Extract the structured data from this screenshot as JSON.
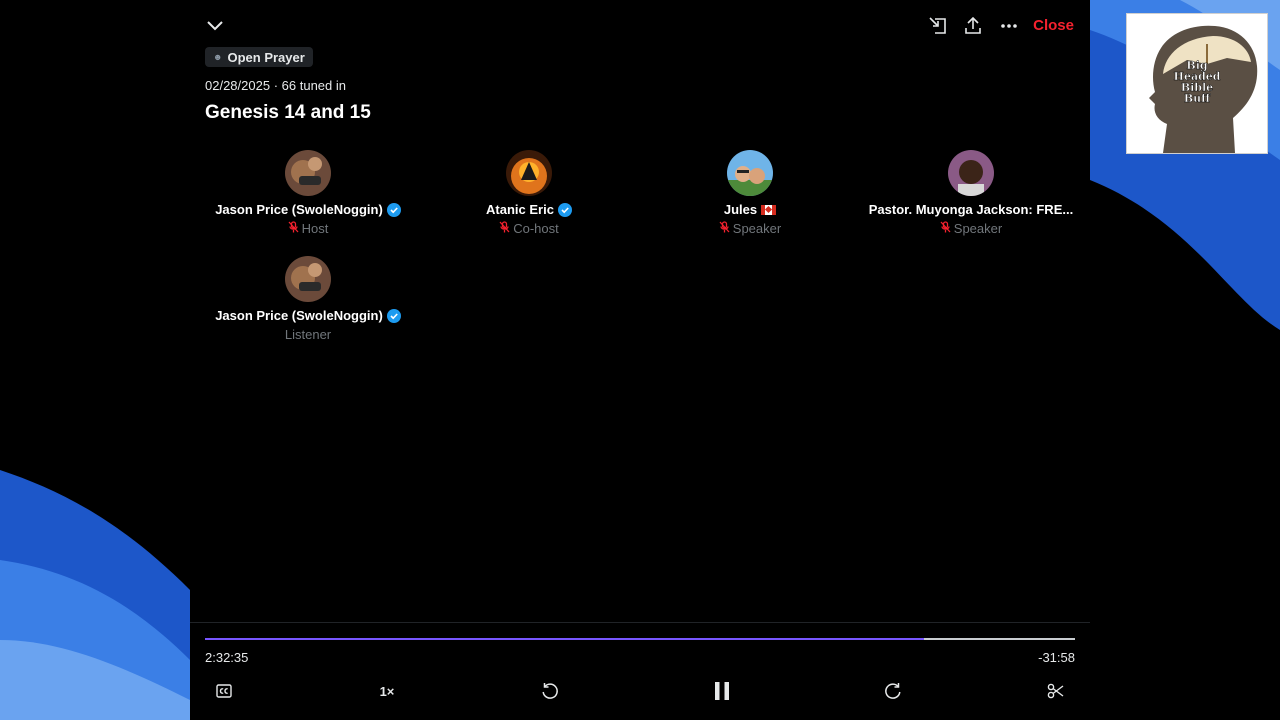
{
  "header": {
    "close_label": "Close"
  },
  "space": {
    "tag_label": "Open Prayer",
    "date": "02/28/2025",
    "tuned_in": "66 tuned in",
    "title": "Genesis 14 and 15"
  },
  "participants": [
    {
      "name": "Jason Price (SwoleNoggin)",
      "role": "Host",
      "verified": true,
      "muted": true
    },
    {
      "name": "Atanic Eric",
      "role": "Co-host",
      "verified": true,
      "muted": true
    },
    {
      "name": "Jules",
      "role": "Speaker",
      "verified": false,
      "muted": true,
      "flag": "canada"
    },
    {
      "name": "Pastor. Muyonga Jackson: FRE...",
      "role": "Speaker",
      "verified": false,
      "muted": true
    },
    {
      "name": "Jason Price (SwoleNoggin)",
      "role": "Listener",
      "verified": true,
      "muted": false
    }
  ],
  "player": {
    "elapsed": "2:32:35",
    "remaining": "-31:58",
    "progress_fraction": 0.827,
    "speed_label": "1×",
    "skip_back_label": "15",
    "skip_forward_label": "15"
  },
  "logo": {
    "text_line1": "Big",
    "text_line2": "Headed",
    "text_line3": "Bible",
    "text_line4": "Buff"
  },
  "icons": {
    "collapse": "chevron-down-icon",
    "minimize": "dock-icon",
    "share": "share-icon",
    "more": "more-icon",
    "captions": "captions-icon",
    "rewind": "rewind-15-icon",
    "pause": "pause-icon",
    "forward": "forward-15-icon",
    "clip": "scissors-icon",
    "muted": "mic-off-icon",
    "verified": "verified-badge-icon"
  },
  "colors": {
    "accent_red": "#f4212e",
    "progress": "#7856ff",
    "verified_blue": "#1d9bf0",
    "background_blue": "#2f6fdf"
  }
}
